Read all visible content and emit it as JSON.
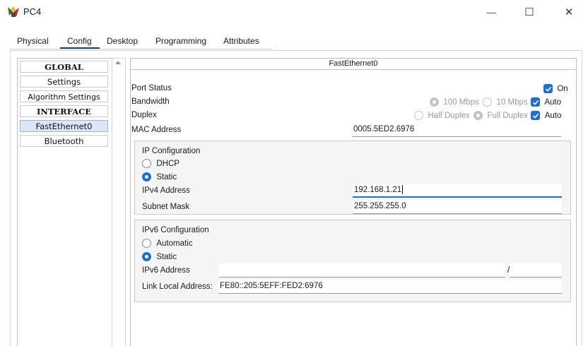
{
  "window": {
    "title": "PC4",
    "app_icon": "packet-tracer-pc-icon",
    "controls": {
      "minimize": "—",
      "maximize": "☐",
      "close": "✕"
    }
  },
  "tabs": [
    {
      "label": "Physical"
    },
    {
      "label": "Config",
      "active": true
    },
    {
      "label": "Desktop"
    },
    {
      "label": "Programming"
    },
    {
      "label": "Attributes"
    }
  ],
  "sidebar": {
    "items": [
      {
        "label": "GLOBAL",
        "header": true
      },
      {
        "label": "Settings"
      },
      {
        "label": "Algorithm Settings"
      },
      {
        "label": "INTERFACE",
        "header": true
      },
      {
        "label": "FastEthernet0",
        "selected": true
      },
      {
        "label": "Bluetooth"
      }
    ]
  },
  "panel": {
    "header": "FastEthernet0",
    "port_status": {
      "label": "Port Status",
      "on_label": "On",
      "on_checked": true
    },
    "bandwidth": {
      "label": "Bandwidth",
      "opt100": "100 Mbps",
      "opt10": "10 Mbps",
      "auto": "Auto",
      "auto_checked": true
    },
    "duplex": {
      "label": "Duplex",
      "half": "Half Duplex",
      "full": "Full Duplex",
      "auto": "Auto",
      "auto_checked": true
    },
    "mac": {
      "label": "MAC Address",
      "value": "0005.5ED2.6976"
    },
    "ipv4": {
      "title": "IP Configuration",
      "dhcp": "DHCP",
      "static": "Static",
      "mode": "Static",
      "address_label": "IPv4 Address",
      "address_value": "192.168.1.21",
      "mask_label": "Subnet Mask",
      "mask_value": "255.255.255.0"
    },
    "ipv6": {
      "title": "IPv6 Configuration",
      "automatic": "Automatic",
      "static": "Static",
      "mode": "Static",
      "address_label": "IPv6 Address",
      "address_value": "",
      "prefix_sep": "/",
      "prefix_value": "",
      "link_local_label": "Link Local Address:",
      "link_local_value": "FE80::205:5EFF:FED2:6976"
    }
  },
  "colors": {
    "accent": "#1f6fd1",
    "tab_underline": "#1d3f7a",
    "group_bg": "#f5f5f5"
  }
}
